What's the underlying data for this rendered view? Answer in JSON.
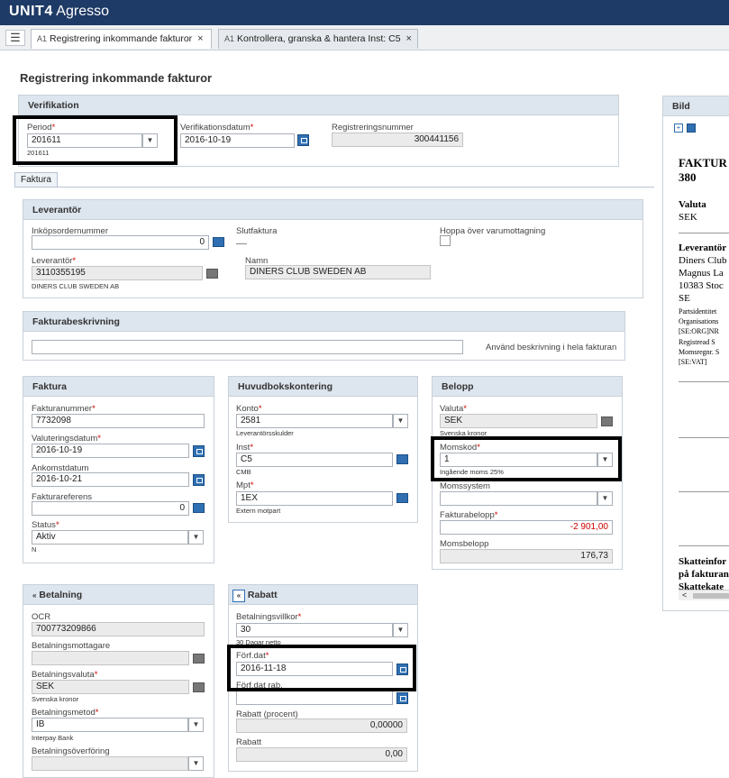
{
  "app": {
    "brand": "UNIT4",
    "name": "Agresso"
  },
  "tabs": [
    {
      "prefix": "A1",
      "label": "Registrering inkommande fakturor",
      "close": "×"
    },
    {
      "prefix": "A1",
      "label": "Kontrollera, granska & hantera Inst: C5",
      "close": "×"
    }
  ],
  "page_title": "Registrering inkommande fakturor",
  "verifikation": {
    "title": "Verifikation",
    "period_label": "Period",
    "period_value": "201611",
    "period_sub": "201611",
    "verdatum_label": "Verifikationsdatum",
    "verdatum_value": "2016-10-19",
    "regnr_label": "Registreringsnummer",
    "regnr_value": "300441156"
  },
  "faktura_tab": "Faktura",
  "leverantor": {
    "title": "Leverantör",
    "inkop_label": "Inköpsordernummer",
    "inkop_value": "0",
    "slut_label": "Slutfaktura",
    "hoppa_label": "Hoppa över varumottagning",
    "lev_label": "Leverantör",
    "lev_value": "3110355195",
    "lev_sub": "DINERS CLUB SWEDEN AB",
    "namn_label": "Namn",
    "namn_value": "DINERS CLUB SWEDEN AB"
  },
  "beskrivning": {
    "title": "Fakturabeskrivning",
    "value": "",
    "option": "Använd beskrivning i hela fakturan"
  },
  "faktura": {
    "title": "Faktura",
    "nr_label": "Fakturanummer",
    "nr_value": "7732098",
    "val_label": "Valuteringsdatum",
    "val_value": "2016-10-19",
    "ank_label": "Ankomstdatum",
    "ank_value": "2016-10-21",
    "ref_label": "Fakturareferens",
    "ref_value": "0",
    "status_label": "Status",
    "status_value": "Aktiv",
    "status_sub": "N"
  },
  "huvudbok": {
    "title": "Huvudbokskontering",
    "konto_label": "Konto",
    "konto_value": "2581",
    "konto_sub": "Leverantörsskulder",
    "inst_label": "Inst",
    "inst_value": "C5",
    "inst_sub": "CMB",
    "mpt_label": "Mpt",
    "mpt_value": "1EX",
    "mpt_sub": "Extern motpart"
  },
  "belopp": {
    "title": "Belopp",
    "valuta_label": "Valuta",
    "valuta_value": "SEK",
    "valuta_sub": "Svenska kronor",
    "moms_label": "Momskod",
    "moms_value": "1",
    "moms_sub": "Ingående moms 25%",
    "system_label": "Momssystem",
    "system_value": "",
    "fb_label": "Fakturabelopp",
    "fb_value": "-2 901,00",
    "mb_label": "Momsbelopp",
    "mb_value": "176,73"
  },
  "betalning": {
    "title": "Betalning",
    "ocr_label": "OCR",
    "ocr_value": "700773209866",
    "mott_label": "Betalningsmottagare",
    "mott_value": "",
    "valuta_label": "Betalningsvaluta",
    "valuta_value": "SEK",
    "valuta_sub": "Svenska kronor",
    "metod_label": "Betalningsmetod",
    "metod_value": "IB",
    "metod_sub": "Interpay Bank",
    "overf_label": "Betalningsöverföring",
    "overf_value": ""
  },
  "rabatt": {
    "title": "Rabatt",
    "villkor_label": "Betalningsvillkor",
    "villkor_value": "30",
    "villkor_sub": "30 Dagar netto",
    "forf_label": "Förf.dat",
    "forf_value": "2016-11-18",
    "forfrab_label": "Förf.dat rab.",
    "forfrab_value": "",
    "procent_label": "Rabatt (procent)",
    "procent_value": "0,00000",
    "rabatt_label": "Rabatt",
    "rabatt_value": "0,00"
  },
  "bild": {
    "title": "Bild",
    "doc_title": "FAKTUR",
    "doc_number": "380",
    "valuta_h": "Valuta",
    "valuta_v": "SEK",
    "lev_h": "Leverantör",
    "lev_lines": [
      "Diners Club",
      "Magnus La",
      "10383  Stoc",
      "SE"
    ],
    "small_lines": [
      "Partsidentitet",
      "Organisations",
      " [SE:ORG]NR",
      "Registread  S",
      "Momsregnr.  S",
      " [SE:VAT]"
    ],
    "bottom_lines": [
      "Skatteinfor",
      "på fakturan",
      "Skattekate"
    ]
  }
}
